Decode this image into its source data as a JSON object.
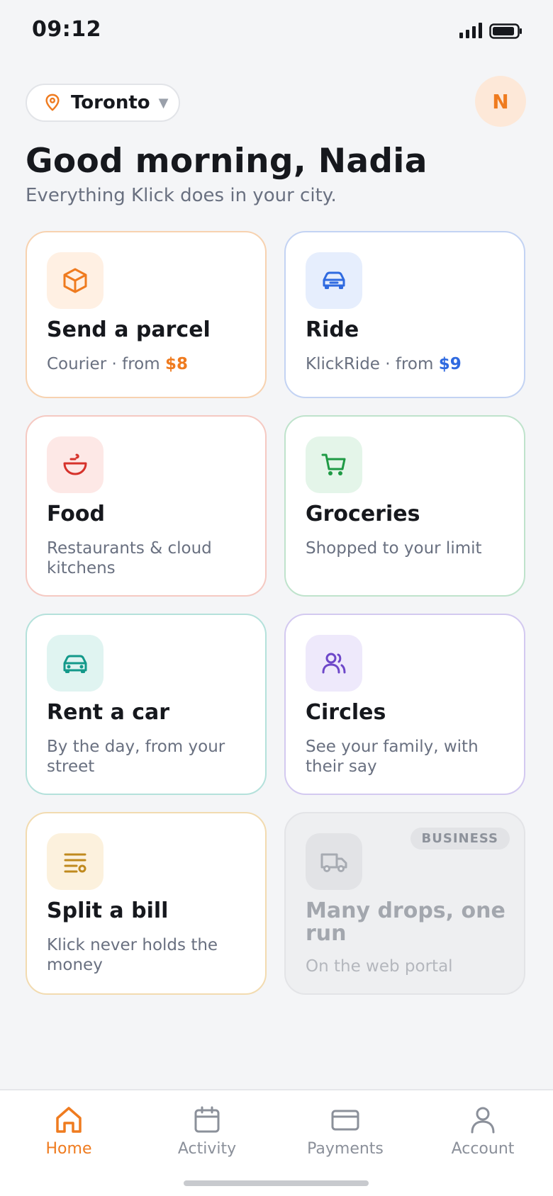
{
  "status_bar": {
    "time": "09:12"
  },
  "header": {
    "city": "Toronto",
    "avatar_initial": "N",
    "greeting": "Good morning, Nadia",
    "subtitle": "Everything Klick does in your city."
  },
  "services": [
    {
      "title": "Send a parcel",
      "desc": "Courier · from ",
      "price": "$8",
      "icon": "box-icon",
      "accent": "#ef7b1f",
      "tile_bg": "#fff0e3",
      "border": "#f7d2b0"
    },
    {
      "title": "Ride",
      "desc": "KlickRide · from ",
      "price": "$9",
      "icon": "car-icon",
      "accent": "#2f6ae0",
      "tile_bg": "#e6eefd",
      "border": "#c3d3f3"
    },
    {
      "title": "Food",
      "desc": "Restaurants & cloud kitchens",
      "icon": "bowl-icon",
      "accent": "#d6322b",
      "tile_bg": "#fde8e6",
      "border": "#f5c9c2"
    },
    {
      "title": "Groceries",
      "desc": "Shopped to your limit",
      "icon": "cart-icon",
      "accent": "#1f9a45",
      "tile_bg": "#e4f5e9",
      "border": "#bfe3cc"
    },
    {
      "title": "Rent a car",
      "desc": "By the day, from your street",
      "icon": "rental-car-icon",
      "accent": "#13998a",
      "tile_bg": "#e0f4f1",
      "border": "#b4e1db"
    },
    {
      "title": "Circles",
      "desc": "See your family, with their say",
      "icon": "people-icon",
      "accent": "#6d47c9",
      "tile_bg": "#eee9fb",
      "border": "#d3c9f0"
    },
    {
      "title": "Split a bill",
      "desc": "Klick never holds the money",
      "icon": "receipt-icon",
      "accent": "#c08a1e",
      "tile_bg": "#fcf1dd",
      "border": "#f2dbb0"
    },
    {
      "title": "Many drops, one run",
      "desc": "On the web portal",
      "badge": "BUSINESS",
      "icon": "truck-icon",
      "accent": "#a7abb2",
      "tile_bg": "#e2e3e6",
      "border": "#e3e4e7"
    }
  ],
  "nav": [
    {
      "label": "Home",
      "icon": "home-icon",
      "active": true
    },
    {
      "label": "Activity",
      "icon": "calendar-icon",
      "active": false
    },
    {
      "label": "Payments",
      "icon": "card-icon",
      "active": false
    },
    {
      "label": "Account",
      "icon": "person-icon",
      "active": false
    }
  ]
}
